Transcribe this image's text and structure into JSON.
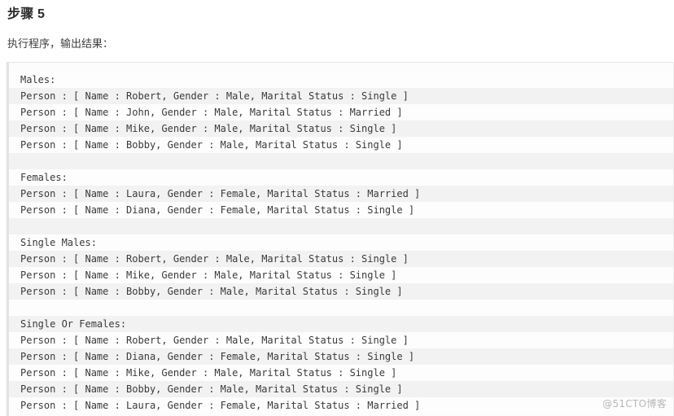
{
  "article": {
    "step_title": "步骤 5",
    "intro_paragraph": "执行程序，输出结果："
  },
  "code_block": {
    "lines": [
      "Males:",
      "Person : [ Name : Robert, Gender : Male, Marital Status : Single ]",
      "Person : [ Name : John, Gender : Male, Marital Status : Married ]",
      "Person : [ Name : Mike, Gender : Male, Marital Status : Single ]",
      "Person : [ Name : Bobby, Gender : Male, Marital Status : Single ]",
      "",
      "Females:",
      "Person : [ Name : Laura, Gender : Female, Marital Status : Married ]",
      "Person : [ Name : Diana, Gender : Female, Marital Status : Single ]",
      "",
      "Single Males:",
      "Person : [ Name : Robert, Gender : Male, Marital Status : Single ]",
      "Person : [ Name : Mike, Gender : Male, Marital Status : Single ]",
      "Person : [ Name : Bobby, Gender : Male, Marital Status : Single ]",
      "",
      "Single Or Females:",
      "Person : [ Name : Robert, Gender : Male, Marital Status : Single ]",
      "Person : [ Name : Diana, Gender : Female, Marital Status : Single ]",
      "Person : [ Name : Mike, Gender : Male, Marital Status : Single ]",
      "Person : [ Name : Bobby, Gender : Male, Marital Status : Single ]",
      "Person : [ Name : Laura, Gender : Female, Marital Status : Married ]"
    ]
  },
  "watermark": {
    "text": "@51CTO博客"
  },
  "colors": {
    "page_background": "#ffffff",
    "code_background": "#fdfdfd",
    "code_stripe": "#f2f2f2",
    "code_left_border": "#e3e3e3",
    "code_text": "#3a3a3a",
    "title_text": "#2b2b2b",
    "watermark_text": "#b4b4b4"
  }
}
